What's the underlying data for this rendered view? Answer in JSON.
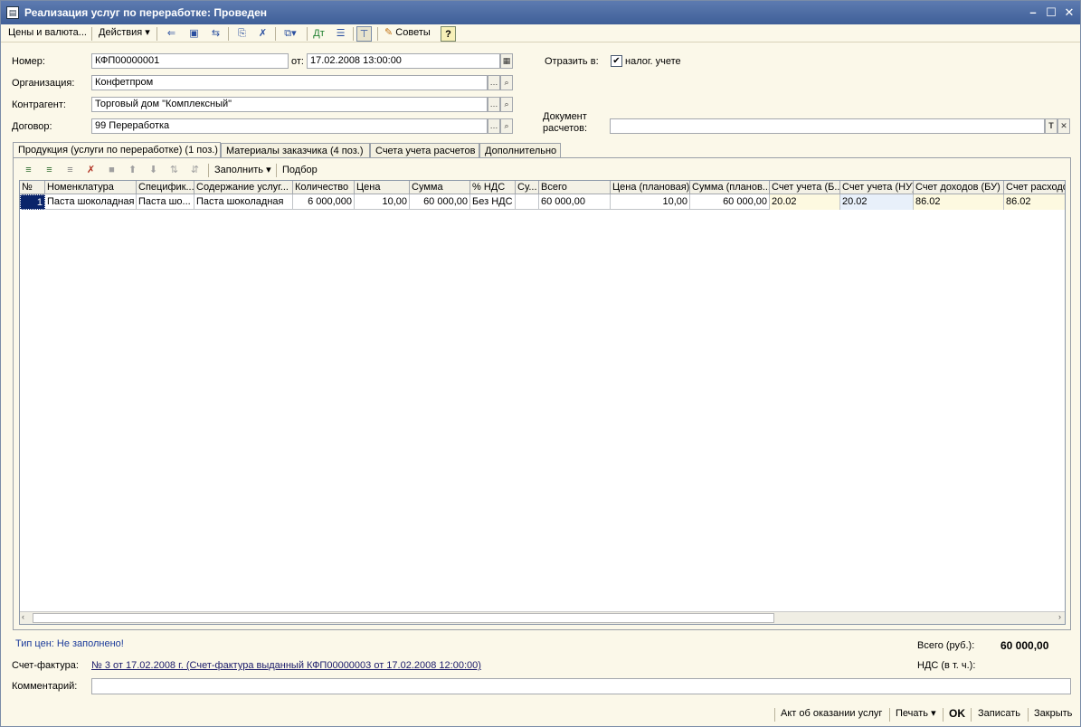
{
  "window": {
    "title": "Реализация услуг по переработке: Проведен",
    "icon": "document-icon"
  },
  "toolbar": {
    "prices": "Цены и валюта...",
    "actions": "Действия",
    "tips": "Советы",
    "help": "?"
  },
  "form": {
    "number_label": "Номер:",
    "number_value": "КФП00000001",
    "date_label": "от:",
    "date_value": "17.02.2008 13:00:00",
    "reflect_label": "Отразить в:",
    "tax_label": "налог. учете",
    "tax_checked": "✔",
    "org_label": "Организация:",
    "org_value": "Конфетпром",
    "counterparty_label": "Контрагент:",
    "counterparty_value": "Торговый дом \"Комплексный\"",
    "contract_label": "Договор:",
    "contract_value": "99 Переработка",
    "settlement_label_1": "Документ",
    "settlement_label_2": "расчетов:",
    "settlement_value": ""
  },
  "tabs": [
    "Продукция (услуги по переработке) (1 поз.)",
    "Материалы заказчика (4 поз.)",
    "Счета учета расчетов",
    "Дополнительно"
  ],
  "panel_toolbar": {
    "fill": "Заполнить",
    "select": "Подбор"
  },
  "table": {
    "columns": [
      "№",
      "Номенклатура",
      "Специфик...",
      "Содержание услуг...",
      "Количество",
      "Цена",
      "Сумма",
      "% НДС",
      "Су...",
      "Всего",
      "Цена (плановая)",
      "Сумма (планов...",
      "Счет учета (Б...",
      "Счет учета (НУ)",
      "Счет доходов (БУ)",
      "Счет расходо"
    ],
    "rows": [
      [
        "1",
        "Паста шоколадная",
        "Паста шо...",
        "Паста шоколадная",
        "6 000,000",
        "10,00",
        "60 000,00",
        "Без НДС",
        "",
        "60 000,00",
        "10,00",
        "60 000,00",
        "20.02",
        "20.02",
        "86.02",
        "86.02"
      ]
    ]
  },
  "footer": {
    "price_type": "Тип цен: Не заполнено!",
    "total_label": "Всего (руб.):",
    "total_value": "60 000,00",
    "vat_label": "НДС (в т. ч.):",
    "invoice_label": "Счет-фактура:",
    "invoice_value": "№ 3 от 17.02.2008 г. (Счет-фактура выданный КФП00000003 от 17.02.2008 12:00:00)",
    "comment_label": "Комментарий:",
    "comment_value": ""
  },
  "statusbar": {
    "act": "Акт об оказании услуг",
    "print": "Печать",
    "ok": "OK",
    "save": "Записать",
    "close": "Закрыть"
  }
}
